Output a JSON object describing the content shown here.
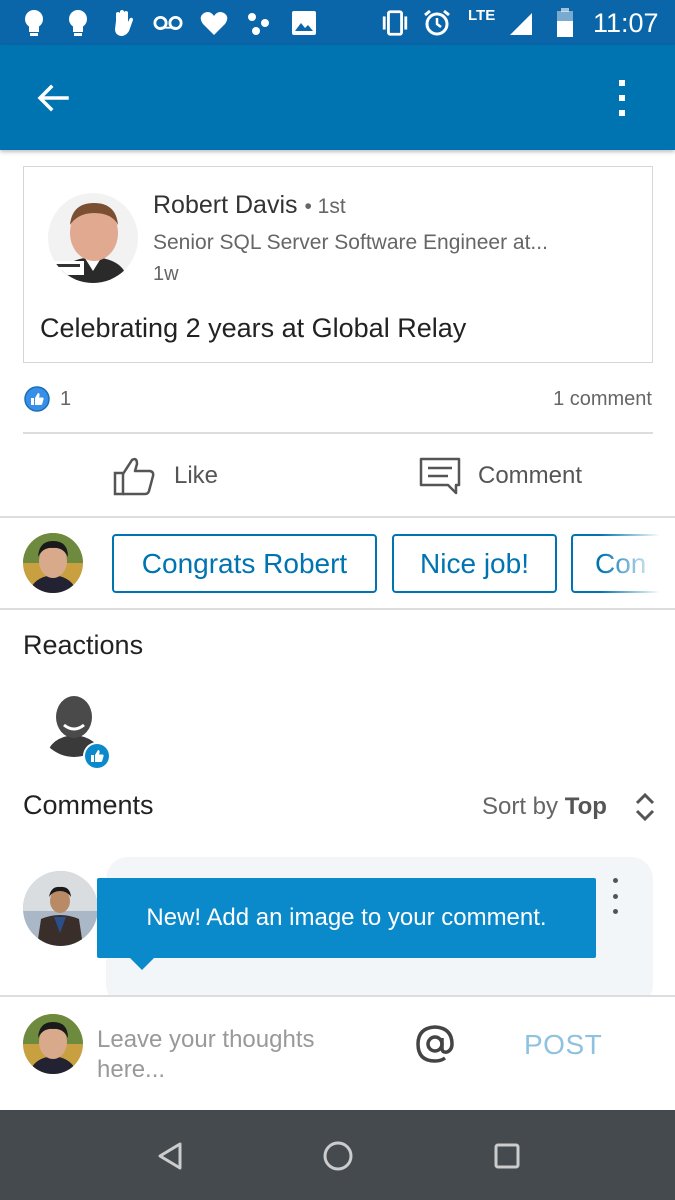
{
  "status_bar": {
    "network": "LTE",
    "time": "11:07",
    "icons": [
      "bulb-icon",
      "bulb-icon",
      "hand-icon",
      "voicemail-icon",
      "heart-icon",
      "dots-icon",
      "image-icon",
      "vibrate-icon",
      "alarm-icon",
      "signal-icon",
      "battery-icon"
    ]
  },
  "post": {
    "author_name": "Robert Davis",
    "connection_degree": "• 1st",
    "author_headline": "Senior SQL Server Software Engineer at...",
    "posted_ago": "1w",
    "text": "Celebrating 2 years at Global Relay"
  },
  "social": {
    "like_count": "1",
    "comment_count": "1 comment"
  },
  "actions": {
    "like_label": "Like",
    "comment_label": "Comment"
  },
  "quick_replies": [
    "Congrats Robert",
    "Nice job!",
    "Con"
  ],
  "reactions": {
    "title": "Reactions"
  },
  "comments": {
    "title": "Comments",
    "sort_prefix": "Sort by",
    "sort_value": "Top"
  },
  "tooltip": {
    "text": "New! Add an image to your comment."
  },
  "compose": {
    "placeholder": "Leave your thoughts here...",
    "post_label": "POST"
  },
  "colors": {
    "brand": "#0073b1",
    "status_bar": "#0a66a8",
    "tooltip": "#0a8acb",
    "nav_bar": "#454a4f"
  }
}
